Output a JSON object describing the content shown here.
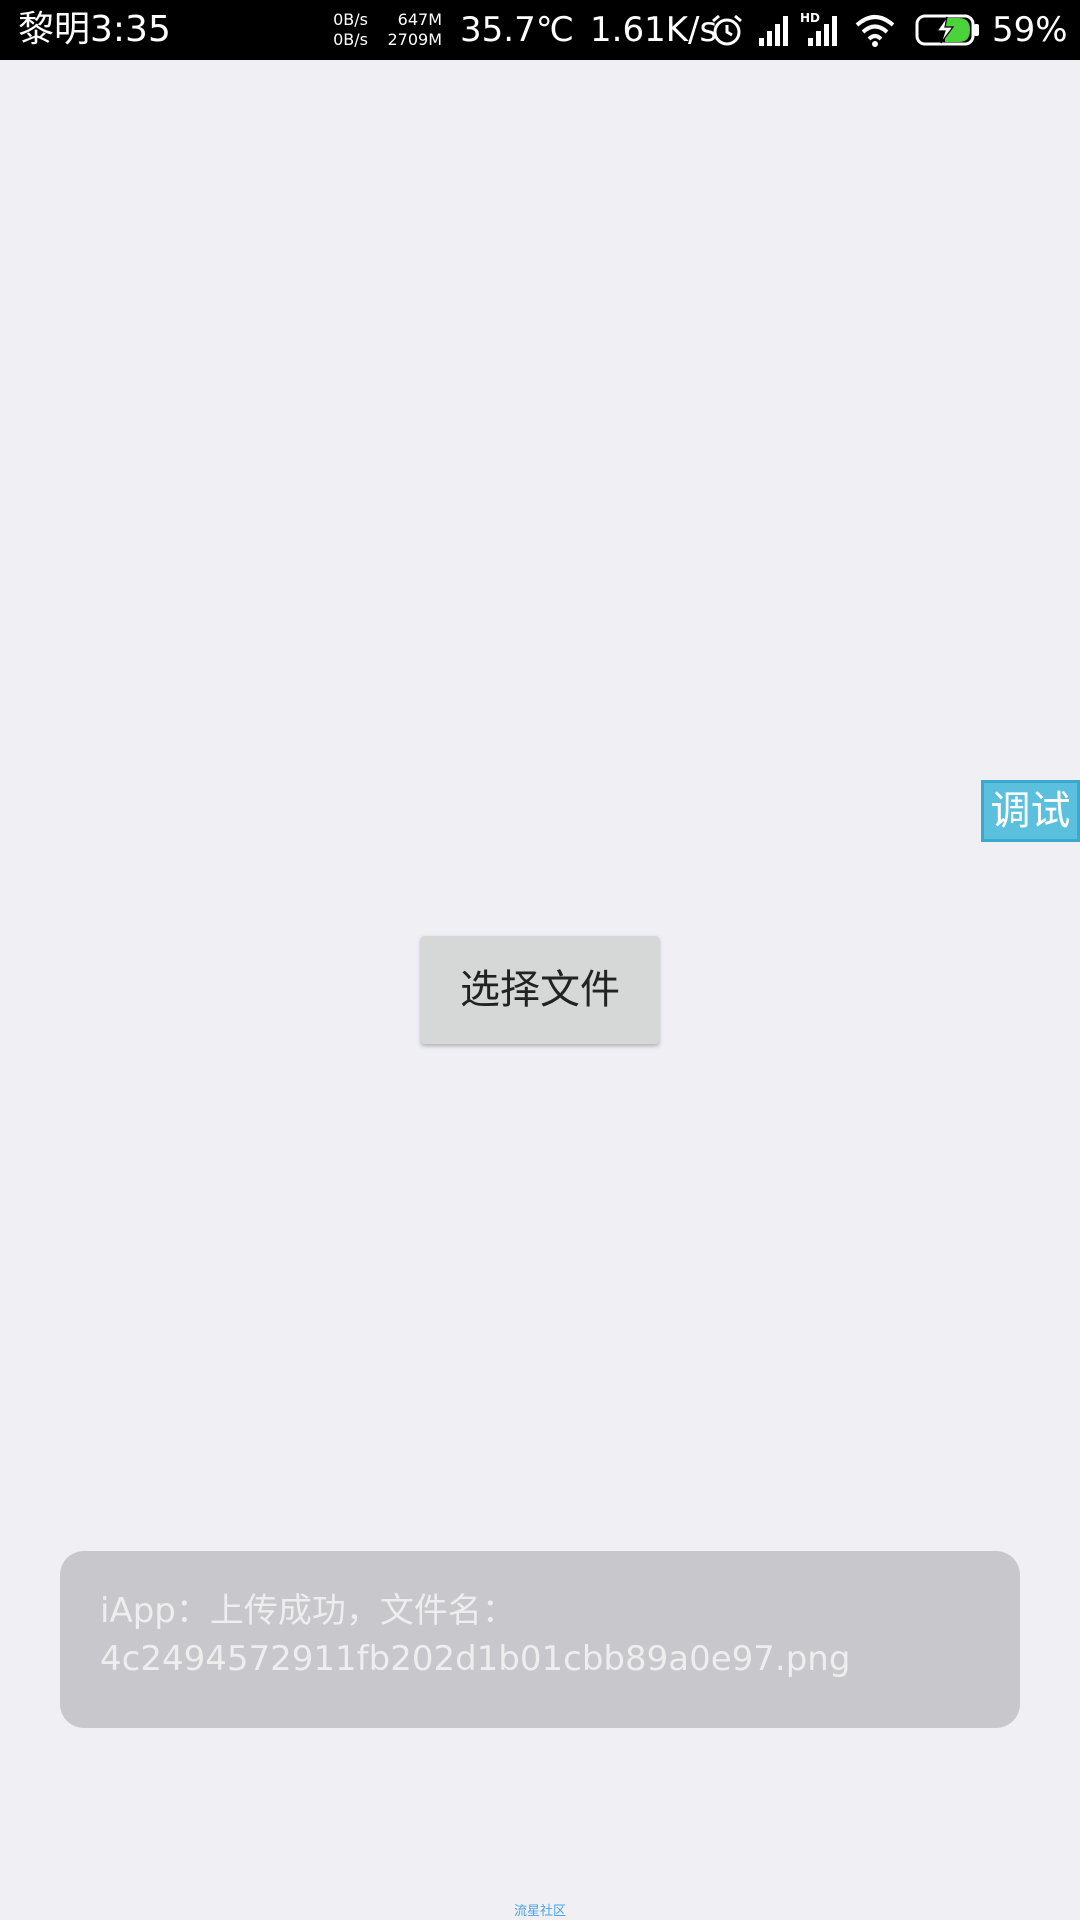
{
  "status_bar": {
    "time": "黎明3:35",
    "net_up": "0B/s",
    "net_down": "0B/s",
    "mem_free": "647M",
    "mem_total": "2709M",
    "temperature": "35.7℃",
    "speed": "1.61K/s",
    "battery_percent": "59%",
    "icons": [
      "alarm-icon",
      "signal-icon",
      "hd-signal-icon",
      "wifi-icon",
      "battery-charging-icon"
    ]
  },
  "debug_button": {
    "label": "调试"
  },
  "main": {
    "select_file_label": "选择文件"
  },
  "toast": {
    "line1": "iApp：上传成功，文件名：",
    "line2": "4c2494572911fb202d1b01cbb89a0e97.png"
  },
  "footer": {
    "watermark": "流星社区"
  },
  "colors": {
    "background": "#efeff4",
    "status_bar": "#000000",
    "debug_button": "#5bc0de",
    "toast": "#c7c7cc",
    "battery_fill": "#4cd23a"
  }
}
